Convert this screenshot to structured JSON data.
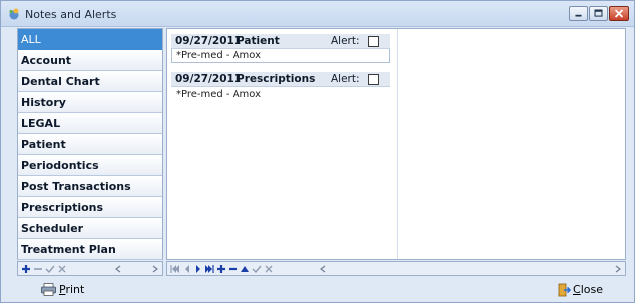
{
  "window": {
    "title": "Notes and Alerts",
    "colors": {
      "selection": "#3d8bd4",
      "nav_icon": "#1a3fa8",
      "close_red": "#c8402a"
    }
  },
  "categories": [
    {
      "label": "ALL",
      "selected": true
    },
    {
      "label": "Account"
    },
    {
      "label": "Dental Chart"
    },
    {
      "label": "History"
    },
    {
      "label": "LEGAL"
    },
    {
      "label": "Patient"
    },
    {
      "label": "Periodontics"
    },
    {
      "label": "Post Transactions"
    },
    {
      "label": "Prescriptions"
    },
    {
      "label": "Scheduler"
    },
    {
      "label": "Treatment Plan"
    }
  ],
  "notes": [
    {
      "date": "09/27/2011",
      "category": "Patient",
      "alert_label": "Alert:",
      "alert_checked": false,
      "text": "*Pre-med - Amox"
    },
    {
      "date": "09/27/2011",
      "category": "Prescriptions",
      "alert_label": "Alert:",
      "alert_checked": false,
      "text": "*Pre-med - Amox"
    }
  ],
  "footer": {
    "print_label": "Print",
    "print_accel": "P",
    "print_rest": "rint",
    "close_accel": "C",
    "close_rest": "lose"
  },
  "icons": {
    "app": "notes-alerts-app-icon",
    "print": "printer-icon",
    "close": "exit-door-icon"
  }
}
